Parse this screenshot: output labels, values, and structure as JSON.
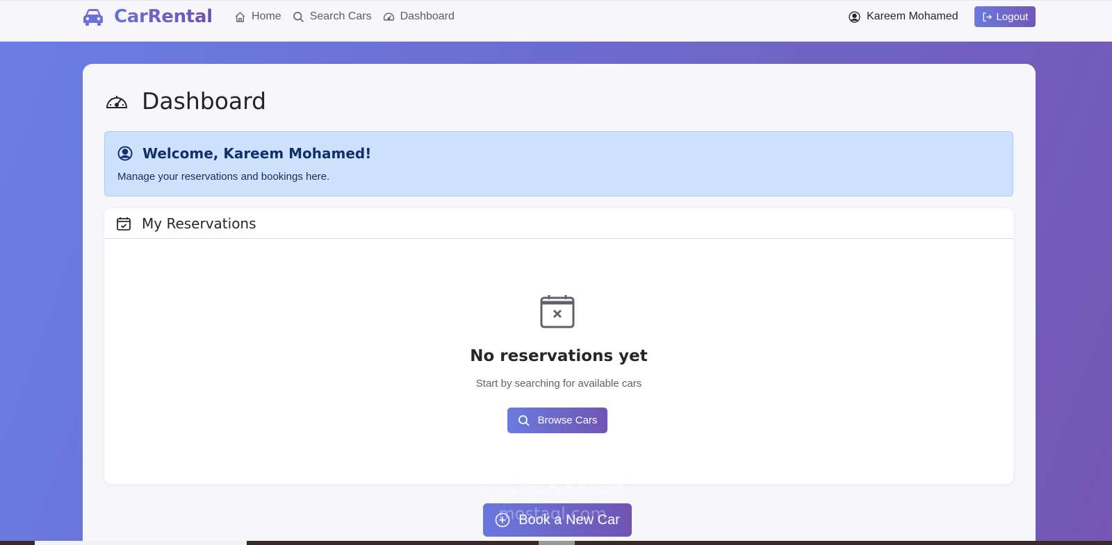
{
  "navbar": {
    "brand": "CarRental",
    "links": [
      {
        "label": "Home",
        "icon": "home-icon"
      },
      {
        "label": "Search Cars",
        "icon": "search-icon"
      },
      {
        "label": "Dashboard",
        "icon": "speedometer-icon"
      }
    ],
    "user_name": "Kareem Mohamed",
    "logout_label": "Logout"
  },
  "page": {
    "title": "Dashboard",
    "welcome_title": "Welcome, Kareem Mohamed!",
    "welcome_subtitle": "Manage your reservations and bookings here.",
    "reservations_title": "My Reservations",
    "empty_title": "No reservations yet",
    "empty_subtitle": "Start by searching for available cars",
    "browse_label": "Browse Cars",
    "book_label": "Book a New Car"
  },
  "watermark": {
    "arabic": "مستقل",
    "latin": "mostaql.com"
  },
  "colors": {
    "accent_start": "#6a7bdf",
    "accent_end": "#7055b5",
    "welcome_bg": "#cfe2fd",
    "welcome_text": "#10306a"
  }
}
